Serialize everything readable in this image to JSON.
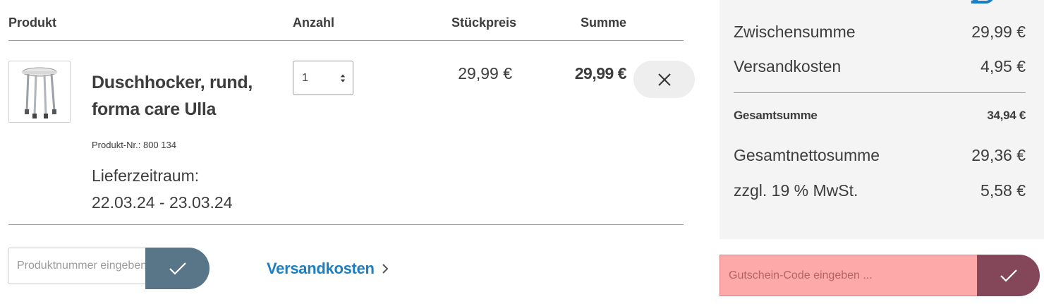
{
  "table": {
    "headers": {
      "product": "Produkt",
      "quantity": "Anzahl",
      "unit_price": "Stückpreis",
      "sum": "Summe"
    }
  },
  "item": {
    "name": "Duschhocker, rund, forma care Ulla",
    "product_number": "Produkt-Nr.: 800 134",
    "delivery_label": "Lieferzeitraum:",
    "delivery_range": "22.03.24 - 23.03.24",
    "quantity": "1",
    "unit_price": "29,99 €",
    "sum": "29,99 €",
    "thumb_icon": "stool-icon",
    "remove_icon": "close-icon"
  },
  "add_product": {
    "placeholder": "Produktnummer eingeben ...",
    "submit_icon": "checkmark-icon"
  },
  "shipping_link": {
    "label": "Versandkosten",
    "icon": "chevron-right-icon"
  },
  "summary": {
    "subtotal_label": "Zwischensumme",
    "subtotal_value": "29,99 €",
    "shipping_label": "Versandkosten",
    "shipping_value": "4,95 €",
    "total_label": "Gesamtsumme",
    "total_value": "34,94 €",
    "net_label": "Gesamtnettosumme",
    "net_value": "29,36 €",
    "vat_label": "zzgl. 19 % MwSt.",
    "vat_value": "5,58 €"
  },
  "voucher": {
    "placeholder": "Gutschein-Code eingeben ...",
    "submit_icon": "checkmark-icon"
  },
  "colors": {
    "link_blue": "#1c7fc3",
    "add_button": "#587687",
    "voucher_button": "#84475a",
    "voucher_field": "#fda9a9",
    "panel_bg": "#f4f4f4"
  }
}
